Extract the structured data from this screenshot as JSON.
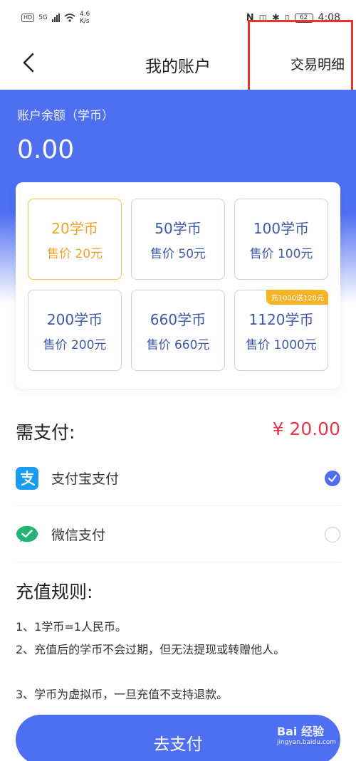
{
  "status_bar": {
    "left_badge": "HD",
    "network": "5G",
    "speed_value": "4.6",
    "speed_unit": "K/s",
    "battery": "62",
    "time": "4:08"
  },
  "nav": {
    "title": "我的账户",
    "detail_link": "交易明细"
  },
  "balance": {
    "label": "账户余额（学币）",
    "value": "0.00"
  },
  "packages": [
    {
      "coins": "20学币",
      "price": "售价 20元",
      "selected": true,
      "tag": ""
    },
    {
      "coins": "50学币",
      "price": "售价 50元",
      "selected": false,
      "tag": ""
    },
    {
      "coins": "100学币",
      "price": "售价 100元",
      "selected": false,
      "tag": ""
    },
    {
      "coins": "200学币",
      "price": "售价 200元",
      "selected": false,
      "tag": ""
    },
    {
      "coins": "660学币",
      "price": "售价 660元",
      "selected": false,
      "tag": ""
    },
    {
      "coins": "1120学币",
      "price": "售价 1000元",
      "selected": false,
      "tag": "充1000送120元"
    }
  ],
  "payment": {
    "label": "需支付:",
    "amount": "¥ 20.00",
    "methods": [
      {
        "label": "支付宝支付",
        "icon": "alipay-icon",
        "checked": true
      },
      {
        "label": "微信支付",
        "icon": "wechat-icon",
        "checked": false
      }
    ]
  },
  "rules": {
    "title": "充值规则:",
    "items": [
      "1、1学币=1人民币。",
      "2、充值后的学币不会过期，但无法提现或转赠他人。",
      "3、学币为虚拟币，一旦充值不支持退款。"
    ]
  },
  "pay_button": "去支付",
  "watermark": {
    "brand": "Bai 经验",
    "url": "jingyan.baidu.com"
  },
  "colors": {
    "primary": "#4f6ff1",
    "selected": "#f0a52a",
    "amount": "#e8374b",
    "highlight_box": "#e8322a"
  }
}
